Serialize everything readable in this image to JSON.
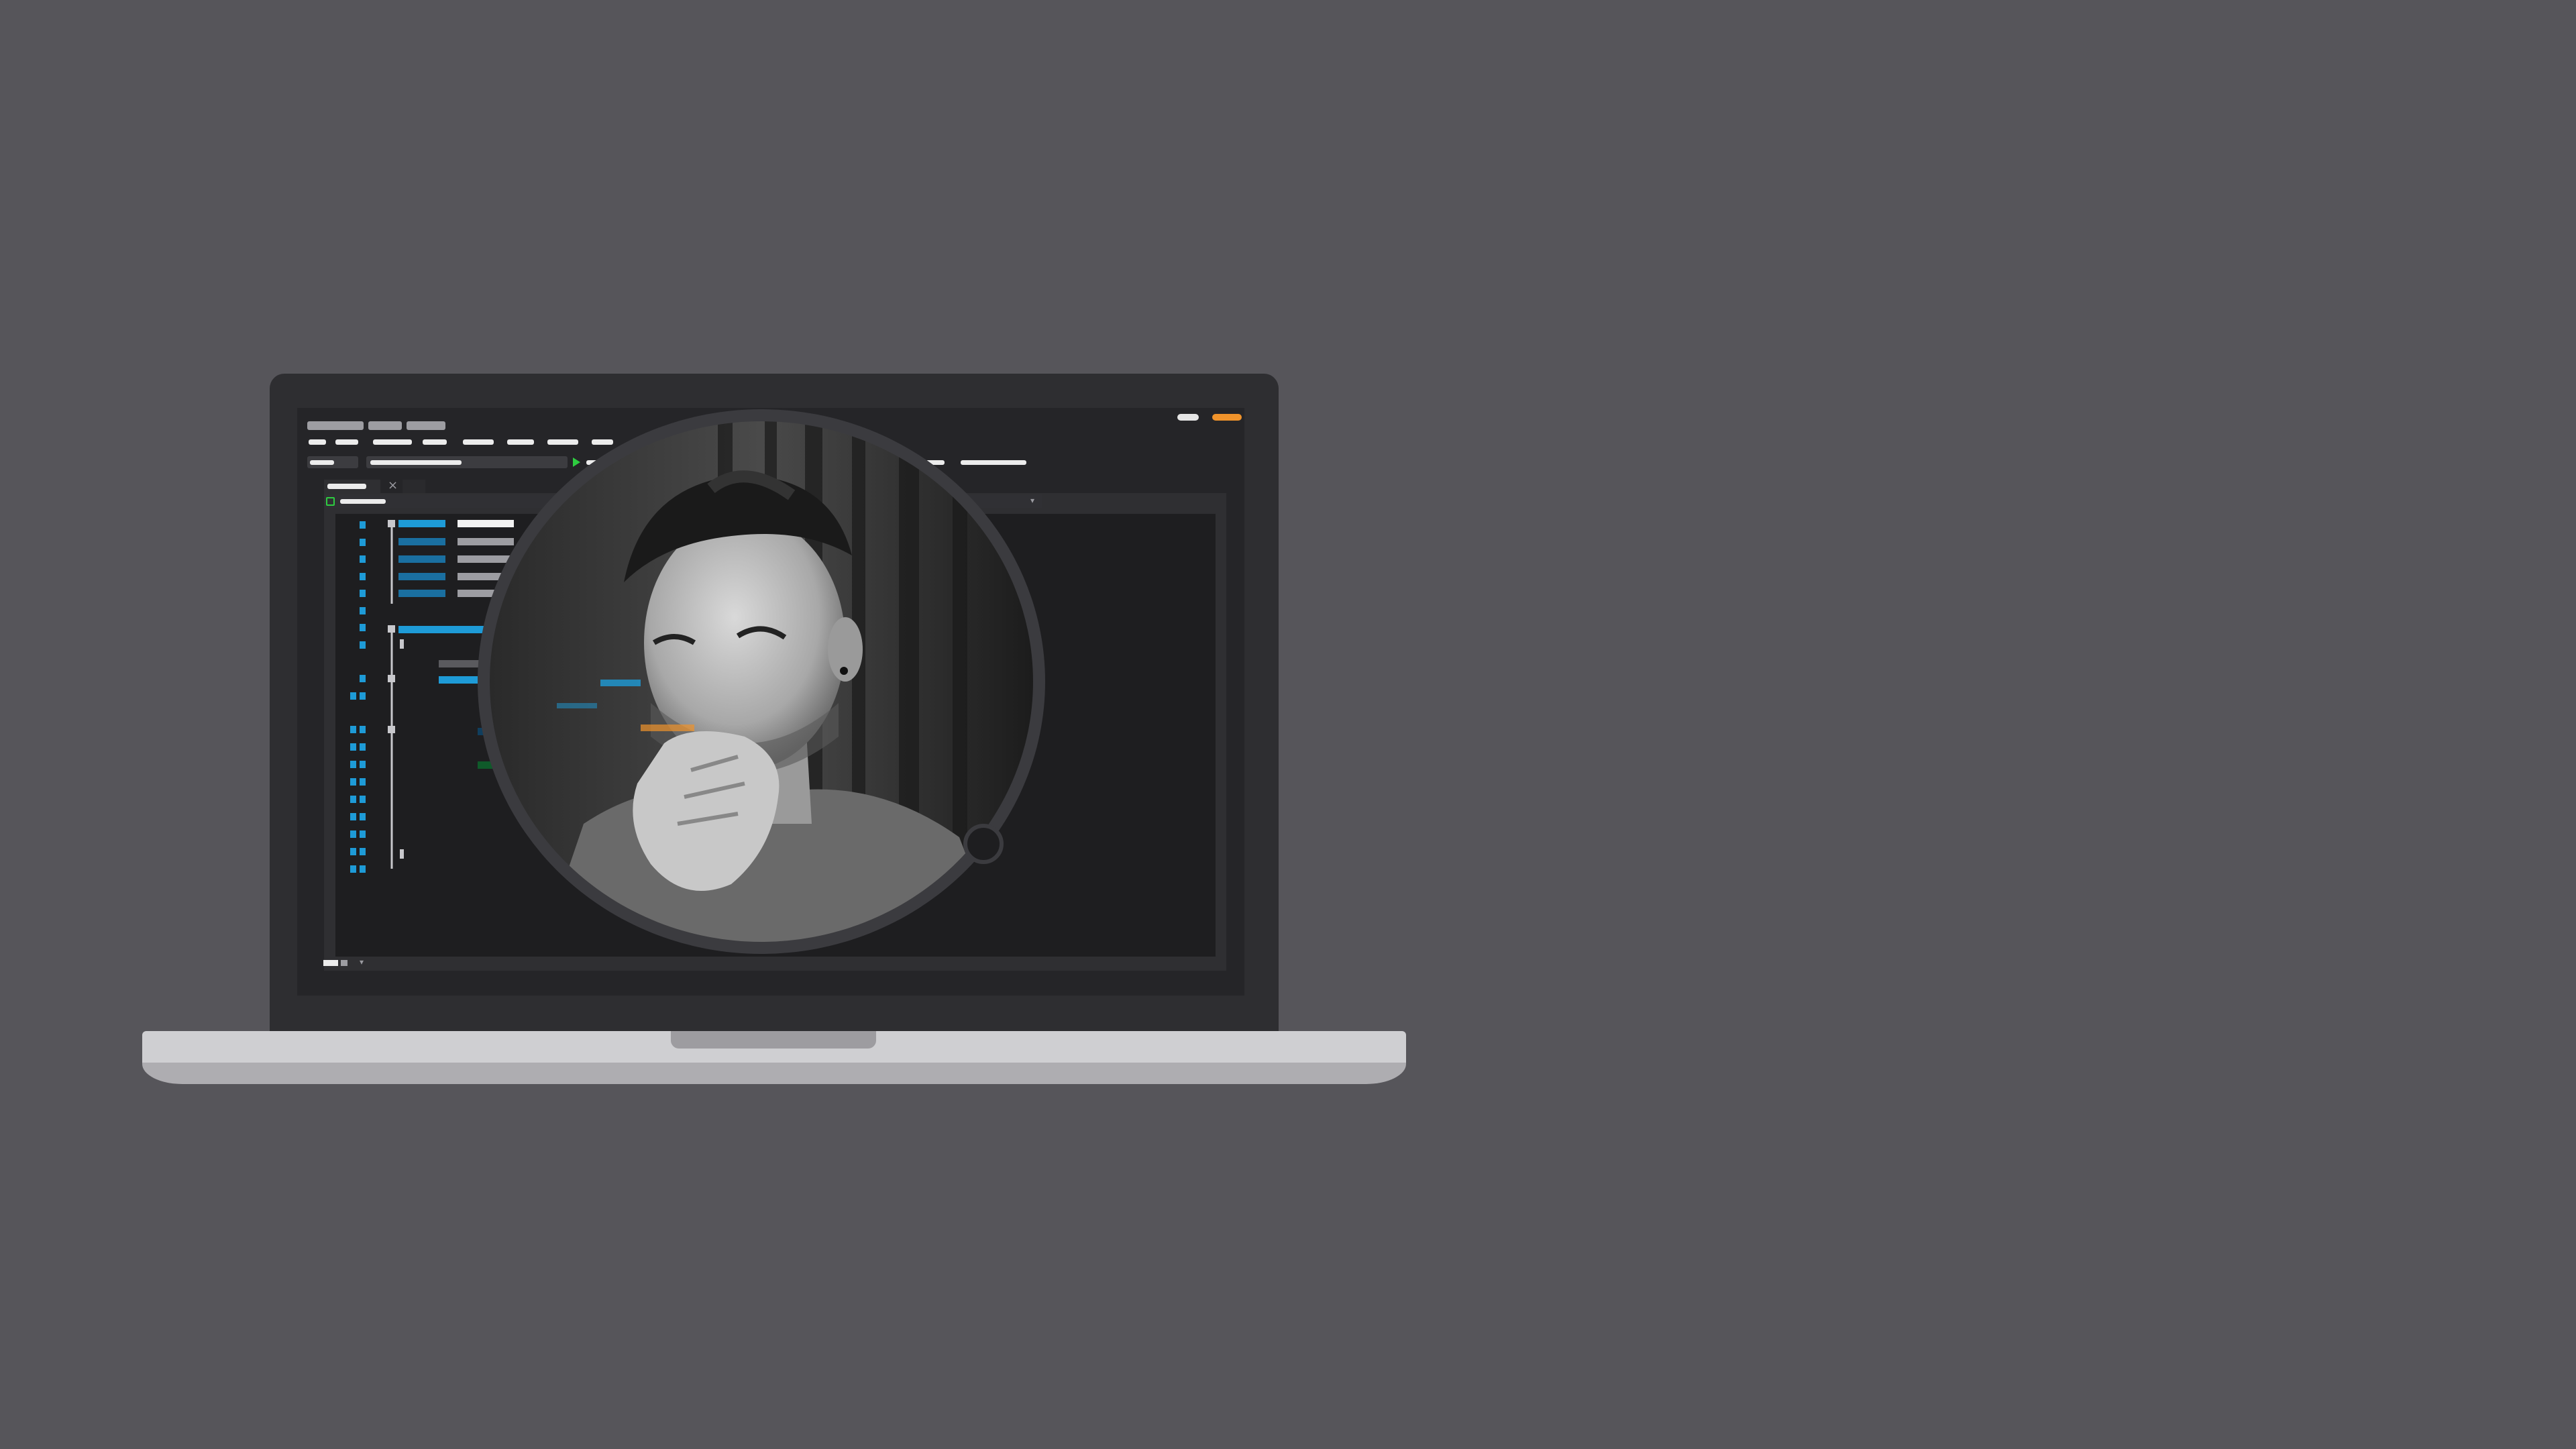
{
  "scene": {
    "background": "#56555a",
    "lid_color": "#2e2e31",
    "screen_color": "#252528",
    "accent_blue": "#1e9bd7",
    "accent_orange": "#f0932b",
    "accent_green": "#2ecc40"
  },
  "window": {
    "close_button_color": "#f0932b",
    "minimize_button_color": "#e6e6e6"
  },
  "editor": {
    "tab_close_icon": "close-icon",
    "status_zoom_dropdown_icon": "chevron-down-icon"
  },
  "portrait": {
    "icon": "person-portrait"
  }
}
